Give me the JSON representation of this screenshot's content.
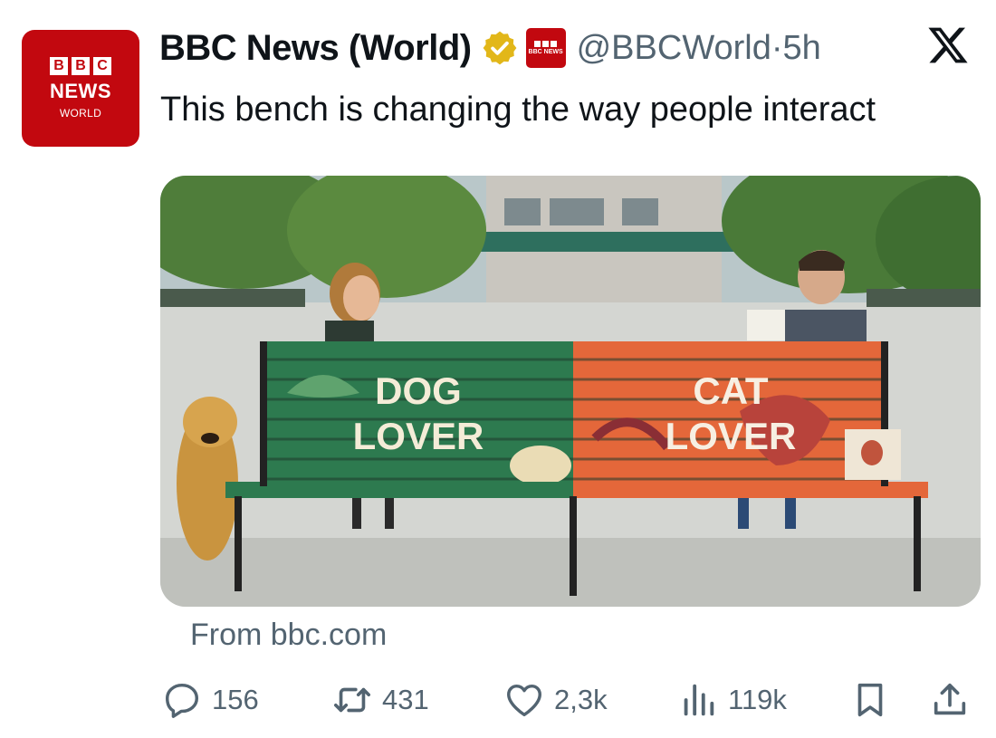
{
  "avatar": {
    "blocks": [
      "B",
      "B",
      "C"
    ],
    "line1": "NEWS",
    "line2": "WORLD"
  },
  "account": {
    "name": "BBC News (World)",
    "handle": "@BBCWorld",
    "separator": "·",
    "time": "5h",
    "affiliate_text": "BBC NEWS"
  },
  "tweet": {
    "text": "This bench is changing the way people interact"
  },
  "image": {
    "bench_left_line1": "DOG",
    "bench_left_line2": "LOVER",
    "bench_right_line1": "CAT",
    "bench_right_line2": "LOVER"
  },
  "card": {
    "source": "From bbc.com"
  },
  "actions": {
    "replies": "156",
    "reposts": "431",
    "likes": "2,3k",
    "views": "119k"
  },
  "icons": [
    "verified-badge-icon",
    "x-logo-icon",
    "reply-icon",
    "repost-icon",
    "like-icon",
    "views-icon",
    "bookmark-icon",
    "share-icon"
  ],
  "colors": {
    "bbc_red": "#c2080f",
    "verified_gold": "#e2b719",
    "text_secondary": "#536471",
    "bench_green": "#2d7a4f",
    "bench_orange": "#e4673a"
  }
}
